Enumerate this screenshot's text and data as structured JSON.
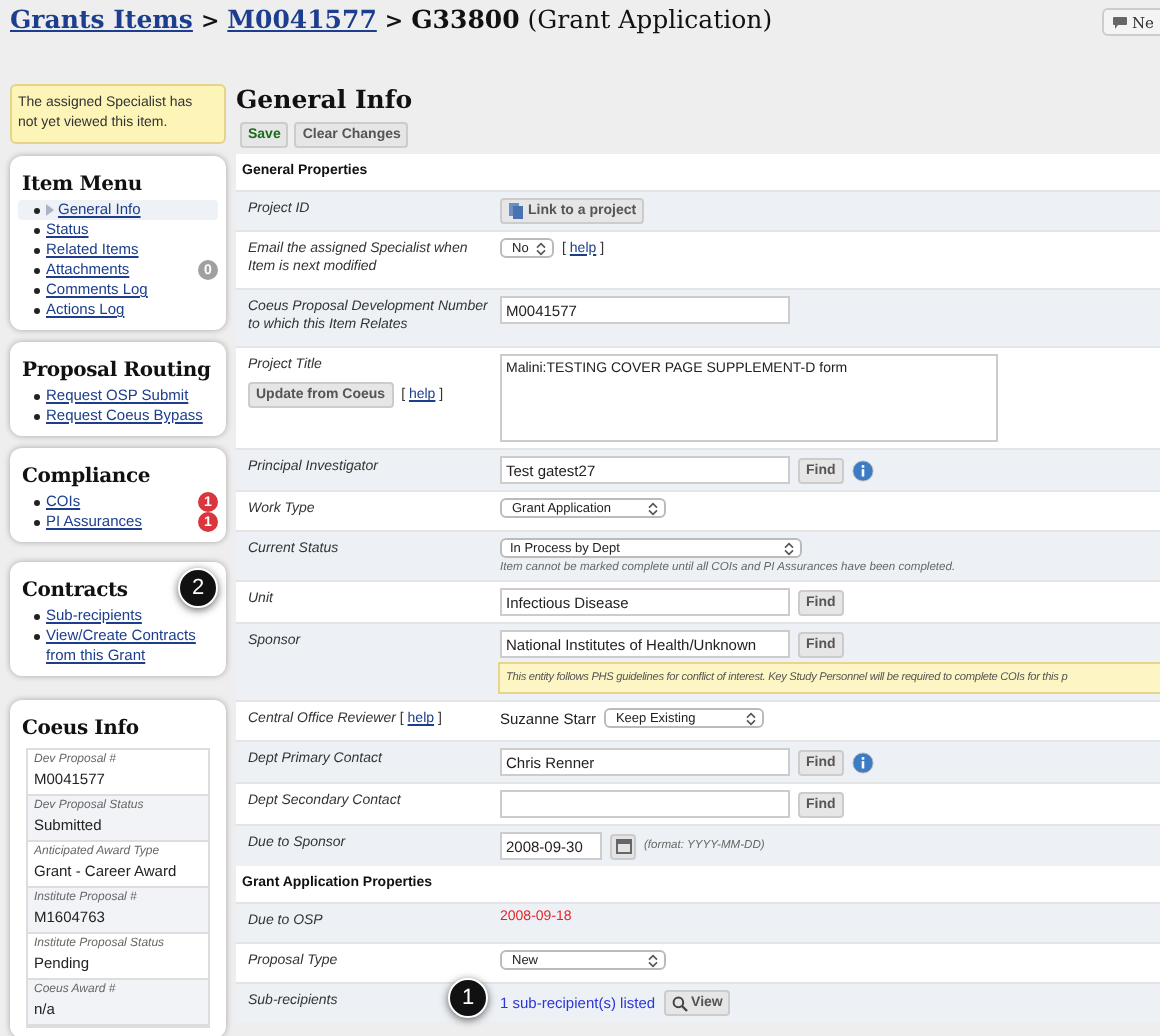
{
  "header": {
    "crumbs": [
      {
        "text": "Grants Items"
      },
      {
        "text": "M0041577"
      }
    ],
    "separator": ">",
    "current": "G33800",
    "suffix": "(Grant Application)",
    "corner_button": "Ne"
  },
  "notice": "The assigned Specialist has not yet viewed this item.",
  "menus": [
    {
      "title": "Item Menu",
      "items": [
        {
          "label": "General Info",
          "selected": true
        },
        {
          "label": "Status",
          "selected": false
        },
        {
          "label": "Related Items",
          "selected": false
        },
        {
          "label": "Attachments",
          "selected": false,
          "badge": "0",
          "color": "#a0a0a0"
        },
        {
          "label": "Comments Log",
          "selected": false
        },
        {
          "label": "Actions Log",
          "selected": false
        }
      ]
    },
    {
      "title": "Proposal Routing",
      "items": [
        {
          "label": "Request OSP Submit",
          "selected": false
        },
        {
          "label": "Request Coeus Bypass",
          "selected": false
        }
      ]
    },
    {
      "title": "Compliance",
      "items": [
        {
          "label": "COIs",
          "selected": false,
          "badge": "1",
          "color": "#d9363e"
        },
        {
          "label": "PI Assurances",
          "selected": false,
          "badge": "1",
          "color": "#d9363e"
        }
      ]
    },
    {
      "title": "Contracts",
      "items": [
        {
          "label": "Sub-recipients",
          "selected": false,
          "callout": "2"
        },
        {
          "label": "View/Create Contracts from this Grant",
          "selected": false
        }
      ]
    }
  ],
  "coeus_info": {
    "title": "Coeus Info",
    "fields": [
      {
        "label": "Dev Proposal #",
        "value": "M0041577"
      },
      {
        "label": "Dev Proposal Status",
        "value": "Submitted"
      },
      {
        "label": "Anticipated Award Type",
        "value": "Grant - Career Award"
      },
      {
        "label": "Institute Proposal #",
        "value": "M1604763"
      },
      {
        "label": "Institute Proposal Status",
        "value": "Pending"
      },
      {
        "label": "Coeus Award #",
        "value": "n/a"
      }
    ]
  },
  "main": {
    "title": "General Info",
    "buttons": [
      {
        "label": "Save",
        "kind": "primary"
      },
      {
        "label": "Clear Changes",
        "kind": "plain"
      }
    ],
    "sections": [
      {
        "title": "General Properties",
        "rows": [
          {
            "label": "Project ID",
            "kind": "button",
            "button": "Link to a project"
          },
          {
            "label": "Email the assigned Specialist when Item is next modified",
            "kind": "select",
            "select": "No",
            "help": {
              "open": "[",
              "link": "help",
              "close": "]"
            }
          },
          {
            "label": "Coeus Proposal Development Number to which this Item Relates",
            "kind": "input",
            "value": "M0041577"
          },
          {
            "label": "Project Title",
            "kind": "textarea",
            "value": "Malini:TESTING COVER PAGE SUPPLEMENT-D form",
            "button": "Update from Coeus",
            "help": {
              "open": "[",
              "link": "help",
              "close": "]"
            }
          },
          {
            "label": "Principal Investigator",
            "kind": "input",
            "value": "Test gatest27",
            "find": "Find",
            "info": true
          },
          {
            "label": "Work Type",
            "kind": "select",
            "select": "Grant Application"
          },
          {
            "label": "Current Status",
            "kind": "select",
            "select": "In Process by Dept",
            "wide": true,
            "note": "Item cannot be marked complete until all COIs and PI Assurances have been completed."
          },
          {
            "label": "Unit",
            "kind": "input",
            "value": "Infectious Disease",
            "find": "Find"
          },
          {
            "label": "Sponsor",
            "kind": "input",
            "value": "National Institutes of Health/Unknown",
            "find": "Find",
            "warning": "This entity follows PHS guidelines for conflict of interest. Key Study Personnel will be required to complete COIs for this p"
          },
          {
            "label": "Central Office Reviewer",
            "label_help": {
              "open": "[",
              "link": "help",
              "close": "]"
            },
            "kind": "reviewer",
            "value": "Suzanne Starr",
            "select": "Keep Existing"
          },
          {
            "label": "Dept Primary Contact",
            "kind": "input",
            "value": "Chris Renner",
            "find": "Find",
            "info": true
          },
          {
            "label": "Dept Secondary Contact",
            "kind": "input",
            "find": "Find"
          },
          {
            "label": "Due to Sponsor",
            "kind": "date",
            "value": "2008-09-30",
            "hint": "(format: YYYY-MM-DD)"
          }
        ]
      },
      {
        "title": "Grant Application Properties",
        "rows": [
          {
            "label": "Due to OSP",
            "kind": "overdue",
            "value": "2008-09-18"
          },
          {
            "label": "Proposal Type",
            "kind": "select",
            "select": "New"
          },
          {
            "label": "Sub-recipients",
            "kind": "link",
            "link": "1 sub-recipient(s) listed",
            "button": "View",
            "callout": "1"
          }
        ]
      }
    ]
  }
}
